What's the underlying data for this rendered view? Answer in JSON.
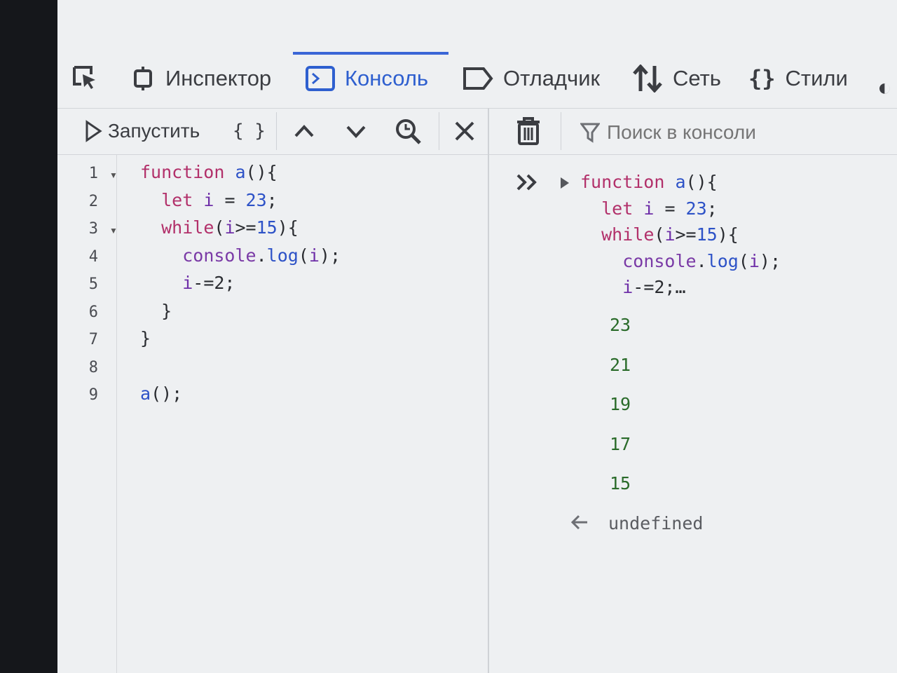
{
  "tabs": [
    {
      "label": "Инспектор",
      "icon": "inspector-icon"
    },
    {
      "label": "Консоль",
      "icon": "console-icon"
    },
    {
      "label": "Отладчик",
      "icon": "debugger-icon"
    },
    {
      "label": "Сеть",
      "icon": "network-icon"
    },
    {
      "label": "Стили",
      "icon": "style-editor-icon"
    }
  ],
  "toolbar": {
    "run_label": "Запустить",
    "pretty_print_label": "{ }",
    "search_placeholder": "Поиск в консоли"
  },
  "editor": {
    "line_numbers": [
      "1",
      "2",
      "3",
      "4",
      "5",
      "6",
      "7",
      "8",
      "9"
    ],
    "lines": [
      {
        "parts": [
          {
            "t": "function",
            "c": "kw"
          },
          {
            "t": " ",
            "c": ""
          },
          {
            "t": "a",
            "c": "fn"
          },
          {
            "t": "(){",
            "c": ""
          }
        ]
      },
      {
        "parts": [
          {
            "t": "  ",
            "c": ""
          },
          {
            "t": "let",
            "c": "kw"
          },
          {
            "t": " ",
            "c": ""
          },
          {
            "t": "i",
            "c": "var"
          },
          {
            "t": " = ",
            "c": ""
          },
          {
            "t": "23",
            "c": "num"
          },
          {
            "t": ";",
            "c": ""
          }
        ]
      },
      {
        "parts": [
          {
            "t": "  ",
            "c": ""
          },
          {
            "t": "while",
            "c": "kw"
          },
          {
            "t": "(",
            "c": ""
          },
          {
            "t": "i",
            "c": "var"
          },
          {
            "t": ">=",
            "c": ""
          },
          {
            "t": "15",
            "c": "num"
          },
          {
            "t": "){",
            "c": ""
          }
        ]
      },
      {
        "parts": [
          {
            "t": "    ",
            "c": ""
          },
          {
            "t": "console",
            "c": "prop"
          },
          {
            "t": ".",
            "c": ""
          },
          {
            "t": "log",
            "c": "fn"
          },
          {
            "t": "(",
            "c": ""
          },
          {
            "t": "i",
            "c": "var"
          },
          {
            "t": ");",
            "c": ""
          }
        ]
      },
      {
        "parts": [
          {
            "t": "    ",
            "c": ""
          },
          {
            "t": "i",
            "c": "var"
          },
          {
            "t": "-=2;",
            "c": ""
          }
        ]
      },
      {
        "parts": [
          {
            "t": "  }",
            "c": ""
          }
        ]
      },
      {
        "parts": [
          {
            "t": "}",
            "c": ""
          }
        ]
      },
      {
        "parts": []
      },
      {
        "parts": [
          {
            "t": "a",
            "c": "fn"
          },
          {
            "t": "();",
            "c": ""
          }
        ]
      }
    ]
  },
  "console": {
    "input_lines": [
      {
        "parts": [
          {
            "t": "function",
            "c": "kw"
          },
          {
            "t": " ",
            "c": ""
          },
          {
            "t": "a",
            "c": "fn"
          },
          {
            "t": "(){",
            "c": ""
          }
        ]
      },
      {
        "parts": [
          {
            "t": "  ",
            "c": ""
          },
          {
            "t": "let",
            "c": "kw"
          },
          {
            "t": " ",
            "c": ""
          },
          {
            "t": "i",
            "c": "var"
          },
          {
            "t": " = ",
            "c": ""
          },
          {
            "t": "23",
            "c": "num"
          },
          {
            "t": ";",
            "c": ""
          }
        ]
      },
      {
        "parts": [
          {
            "t": "  ",
            "c": ""
          },
          {
            "t": "while",
            "c": "kw"
          },
          {
            "t": "(",
            "c": ""
          },
          {
            "t": "i",
            "c": "var"
          },
          {
            "t": ">=",
            "c": ""
          },
          {
            "t": "15",
            "c": "num"
          },
          {
            "t": "){",
            "c": ""
          }
        ]
      },
      {
        "parts": [
          {
            "t": "    ",
            "c": ""
          },
          {
            "t": "console",
            "c": "prop"
          },
          {
            "t": ".",
            "c": ""
          },
          {
            "t": "log",
            "c": "fn"
          },
          {
            "t": "(",
            "c": ""
          },
          {
            "t": "i",
            "c": "var"
          },
          {
            "t": ");",
            "c": ""
          }
        ]
      },
      {
        "parts": [
          {
            "t": "    ",
            "c": ""
          },
          {
            "t": "i",
            "c": "var"
          },
          {
            "t": "-=2;…",
            "c": ""
          }
        ]
      }
    ],
    "outputs": [
      "23",
      "21",
      "19",
      "17",
      "15"
    ],
    "result": "undefined"
  }
}
